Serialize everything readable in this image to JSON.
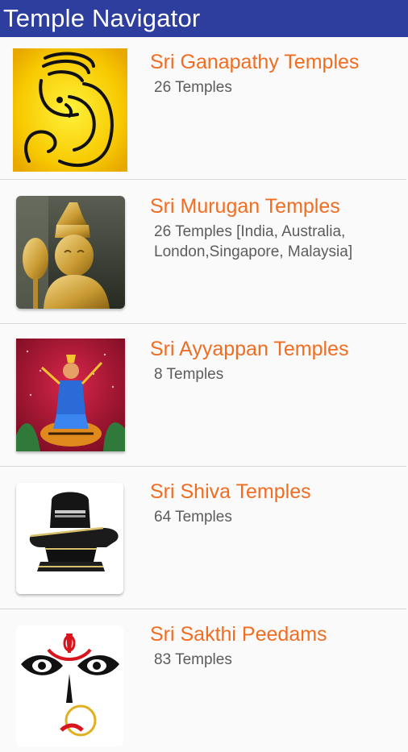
{
  "app": {
    "title": "Temple Navigator"
  },
  "colors": {
    "app_bar": "#2d3e9e",
    "title_accent": "#f06d22",
    "subtitle": "#5c5c5c"
  },
  "temples": [
    {
      "title": "Sri Ganapathy Temples",
      "subtitle": "26 Temples",
      "image": "ganesha-image"
    },
    {
      "title": "Sri Murugan Temples",
      "subtitle": "26 Temples [India, Australia,\nLondon,Singapore, Malaysia]",
      "image": "murugan-image"
    },
    {
      "title": "Sri Ayyappan Temples",
      "subtitle": "8 Temples",
      "image": "ayyappan-image"
    },
    {
      "title": "Sri Shiva Temples",
      "subtitle": "64 Temples",
      "image": "shiva-lingam-image"
    },
    {
      "title": "Sri Sakthi Peedams",
      "subtitle": "83 Temples",
      "image": "sakthi-image"
    }
  ]
}
